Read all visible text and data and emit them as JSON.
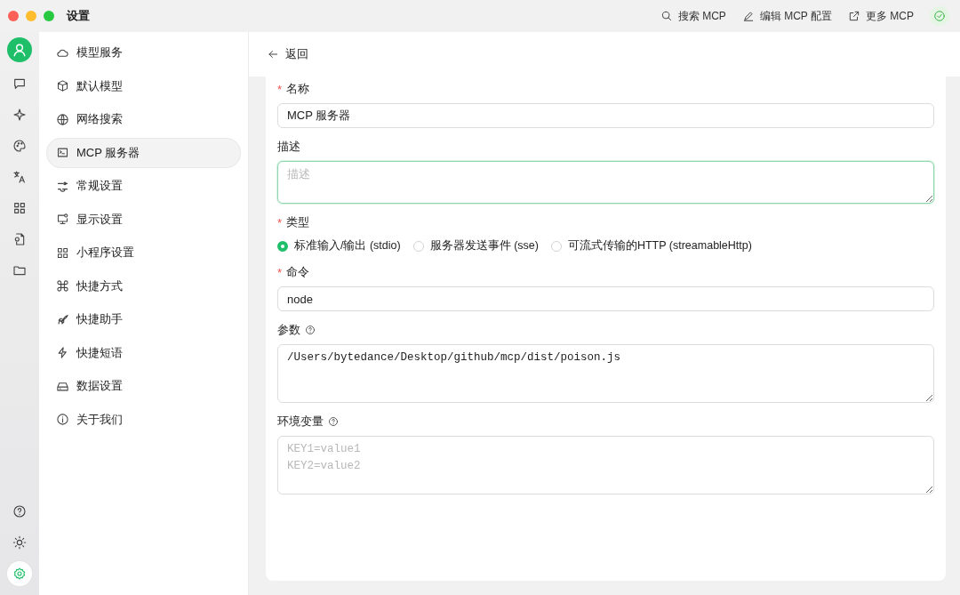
{
  "window": {
    "title": "设置"
  },
  "toolbar": [
    {
      "kind": "search",
      "label": "搜索 MCP"
    },
    {
      "kind": "edit",
      "label": "编辑 MCP 配置"
    },
    {
      "kind": "external",
      "label": "更多 MCP"
    }
  ],
  "rail": {
    "top": [
      {
        "selected": false
      },
      {
        "selected": false
      },
      {
        "selected": false
      },
      {
        "selected": false
      },
      {
        "selected": false
      },
      {
        "selected": false
      },
      {
        "selected": false
      }
    ],
    "bottom": [
      {
        "selected": false
      },
      {
        "selected": false
      },
      {
        "selected": true
      }
    ]
  },
  "sidebar": {
    "items": [
      {
        "label": "模型服务",
        "selected": false
      },
      {
        "label": "默认模型",
        "selected": false
      },
      {
        "label": "网络搜索",
        "selected": false
      },
      {
        "label": "MCP 服务器",
        "selected": true
      },
      {
        "label": "常规设置",
        "selected": false
      },
      {
        "label": "显示设置",
        "selected": false
      },
      {
        "label": "小程序设置",
        "selected": false
      },
      {
        "label": "快捷方式",
        "selected": false
      },
      {
        "label": "快捷助手",
        "selected": false
      },
      {
        "label": "快捷短语",
        "selected": false
      },
      {
        "label": "数据设置",
        "selected": false
      },
      {
        "label": "关于我们",
        "selected": false
      }
    ]
  },
  "back": {
    "label": "返回"
  },
  "form": {
    "fields": [
      {
        "kind": "input",
        "required_mark": "*",
        "label": "名称",
        "help": false,
        "value": "MCP 服务器"
      },
      {
        "kind": "short-textarea",
        "label": "描述",
        "help": false,
        "placeholder": "描述",
        "focused": true
      },
      {
        "kind": "radio",
        "required_mark": "*",
        "label": "类型",
        "help": false,
        "options": [
          {
            "label": "标准输入/输出 (stdio)",
            "selected": true
          },
          {
            "label": "服务器发送事件 (sse)",
            "selected": false
          },
          {
            "label": "可流式传输的HTTP (streamableHttp)",
            "selected": false
          }
        ]
      },
      {
        "kind": "input",
        "required_mark": "*",
        "label": "命令",
        "help": false,
        "value": "node"
      },
      {
        "kind": "textarea",
        "label": "参数",
        "help": true,
        "value": "/Users/bytedance/Desktop/github/mcp/dist/poison.js",
        "focused": false
      },
      {
        "kind": "textarea",
        "label": "环境变量",
        "help": true,
        "placeholder": "KEY1=value1\nKEY2=value2",
        "focused": false
      }
    ]
  }
}
